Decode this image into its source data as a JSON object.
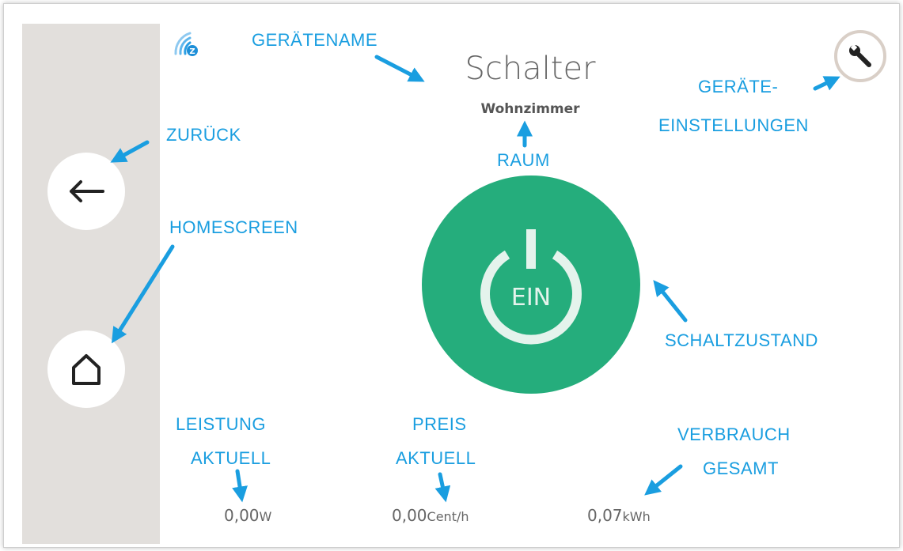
{
  "device": {
    "name": "Schalter",
    "room": "Wohnzimmer"
  },
  "power_button": {
    "state_label": "EIN",
    "state": "on",
    "color": "#25ad7c"
  },
  "sidebar": {
    "back_icon": "arrow-left-icon",
    "home_icon": "home-icon",
    "color": "#e2dfdc"
  },
  "header": {
    "connection_icon": "zwave-icon",
    "settings_icon": "wrench-icon"
  },
  "readings": {
    "power": {
      "value": "0,00",
      "unit": "W"
    },
    "price": {
      "value": "0,00",
      "unit": "Cent/h"
    },
    "consumption": {
      "value": "0,07",
      "unit": "kWh"
    }
  },
  "annotations": {
    "device_name": "GERÄTENAME",
    "room": "RAUM",
    "back": "ZURÜCK",
    "home": "HOMESCREEN",
    "settings_line1": "GERÄTE-",
    "settings_line2": "EINSTELLUNGEN",
    "state": "SCHALTZUSTAND",
    "power_line1": "LEISTUNG",
    "power_line2": "AKTUELL",
    "price_line1": "PREIS",
    "price_line2": "AKTUELL",
    "consumption_line1": "VERBRAUCH",
    "consumption_line2": "GESAMT",
    "color": "#1a9ee0"
  }
}
